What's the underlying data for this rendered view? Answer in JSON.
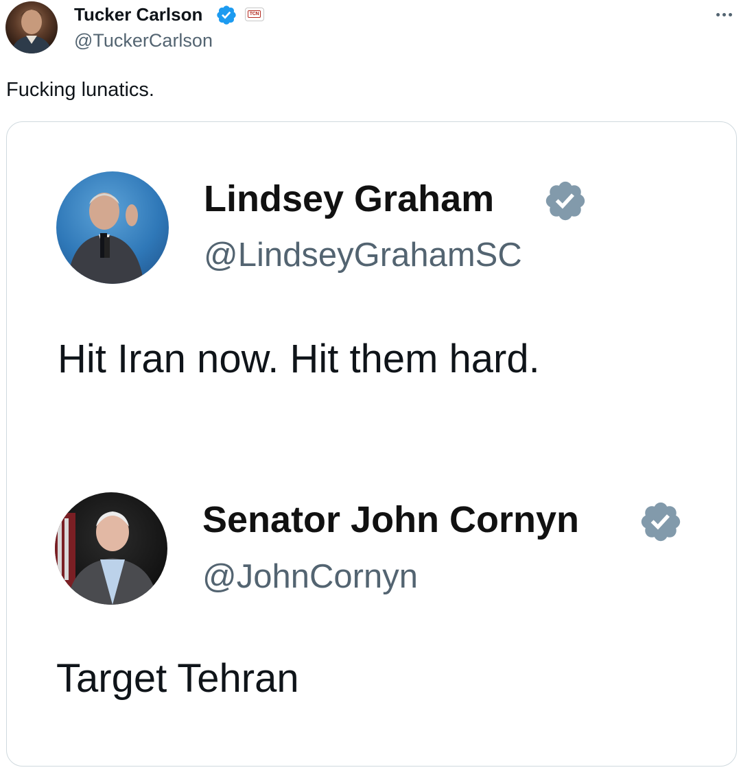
{
  "post": {
    "author": {
      "name": "Tucker Carlson",
      "handle": "@TuckerCarlson",
      "verified_color": "#1d9bf0",
      "affiliate_badge_icon": "tcn-logo-icon",
      "affiliate_badge_text": "TCN"
    },
    "more_icon": "more-horizontal-icon",
    "text": "Fucking lunatics.",
    "media": {
      "quoted_posts": [
        {
          "name": "Lindsey Graham",
          "handle": "@LindseyGrahamSC",
          "text": "Hit Iran now. Hit them hard.",
          "badge_color": "#829aab"
        },
        {
          "name": "Senator John Cornyn",
          "handle": "@JohnCornyn",
          "text": "Target Tehran",
          "badge_color": "#829aab"
        }
      ]
    }
  },
  "colors": {
    "text_primary": "#0f1419",
    "text_secondary": "#536471",
    "border": "#cfd9de"
  }
}
